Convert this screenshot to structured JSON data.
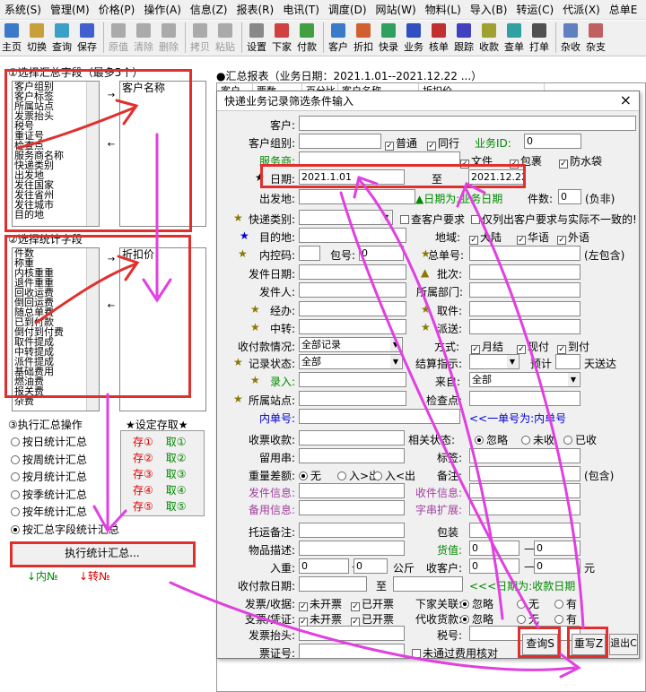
{
  "menu": [
    "系统(S)",
    "管理(M)",
    "价格(P)",
    "操作(A)",
    "信息(Z)",
    "报表(R)",
    "电讯(T)",
    "调度(D)",
    "网站(W)",
    "物料(L)",
    "导入(B)",
    "转运(C)",
    "代派(X)",
    "总单E"
  ],
  "toolbar": [
    "主页",
    "切换",
    "查询",
    "保存",
    "原值",
    "清除",
    "删除",
    "拷贝",
    "粘贴",
    "设置",
    "下家",
    "付款",
    "客户",
    "折扣",
    "快录",
    "业务",
    "核单",
    "跟踪",
    "收款",
    "查单",
    "打单",
    "杂收",
    "杂支"
  ],
  "left": {
    "select_title": "①选择汇总字段（最多5个）",
    "select_items": [
      "客户组别",
      "客户标签",
      "所属站点",
      "发票抬头",
      "税号",
      "重证号",
      "检查点",
      "服务商名称",
      "快递类别",
      "出发地",
      "发往国家",
      "发往省州",
      "发往城市",
      "目的地"
    ],
    "selected_select": "客户名称",
    "stat_title": "②选择统计字段",
    "stat_items": [
      "件数",
      "称重",
      "内核重重",
      "退件重重",
      "回收运费",
      "倒回运费",
      "随总单费",
      "已到付款",
      "倒付到付费",
      "取件提成",
      "中转提成",
      "派件提成",
      "基础费用",
      "燃油费",
      "报关费",
      "杂费"
    ],
    "selected_stat": "折扣价",
    "exec_title": "③执行汇总操作",
    "options": [
      "按日统计汇总",
      "按周统计汇总",
      "按月统计汇总",
      "按季统计汇总",
      "按年统计汇总",
      "按汇总字段统计汇总"
    ],
    "store_title": "★设定存取★",
    "store_save": [
      "存①",
      "存②",
      "存③",
      "存④",
      "存⑤"
    ],
    "store_load": [
      "取①",
      "取②",
      "取③",
      "取④",
      "取⑤"
    ],
    "exec_button": "执行统计汇总...",
    "foot_in": "↓内№",
    "foot_out": "↓转№"
  },
  "report": {
    "title": "●汇总报表（业务日期：2021.1.01--2021.12.22 ...）",
    "cols": [
      "客户",
      "票数",
      "百分比",
      "客户名称",
      "折扣价"
    ]
  },
  "dialog": {
    "title": "快递业务记录筛选条件输入",
    "close": "×",
    "l": {
      "customer": "客户:",
      "group": "客户组别:",
      "provider": "服务商:",
      "date": "日期:",
      "origin": "出发地:",
      "ktype": "快递类别:",
      "dest": "目的地:",
      "inner": "内控码:",
      "bag": "包号:",
      "sdate": "发件日期:",
      "sender": "发件人:",
      "handler": "经办:",
      "transit": "中转:",
      "paystat": "收付款情况:",
      "recstat": "记录状态:",
      "entry": "录入:",
      "site": "所属站点:",
      "inno": "内单号:",
      "recv": "收票收款:",
      "keep": "留用串:",
      "wdiff": "重量差额:",
      "sendinfo": "发件信息:",
      "backinfo": "备用信息:",
      "consign": "托运备注:",
      "goods": "物品描述:",
      "weight": "入重:",
      "paydate": "收付款日期:",
      "invoice": "发票/收据:",
      "voucher": "支票/凭证:",
      "invtitle": "发票抬头:",
      "certno": "票证号:"
    },
    "r": {
      "bizid": "业务ID:",
      "bizid_val": "0",
      "common": "普通",
      "peer": "同行",
      "doc": "文件",
      "pkg": "包裹",
      "water": "防水袋",
      "to": "至",
      "datehint": "▲日期为:业务日期",
      "pieces": "件数:",
      "pieces_val": "0",
      "neg": "(负非)",
      "cust_req": "查客户要求",
      "cust_diff": "仅列出客户要求与实际不一致的!",
      "region": "地域:",
      "mainland": "大陆",
      "chinese": "华语",
      "foreign": "外语",
      "master": "总单号:",
      "left_inc": "(左包含)",
      "batch": "批次:",
      "dept": "所属部门:",
      "pickup": "取件:",
      "dispatch": "派送:",
      "mode": "方式:",
      "monthly": "月结",
      "cash": "现付",
      "arrive": "到付",
      "settle": "结算指示:",
      "prepay": "预计",
      "dayarrive": "天送达",
      "from": "来自:",
      "check": "检查点:",
      "singleno": "<<一单号为:内单号",
      "related": "相关状态:",
      "ignore": "忽略",
      "unrecv": "未收",
      "recved": "已收",
      "tag": "标签:",
      "note": "备注:",
      "incl": "(包含)",
      "recvinfo": "收件信息:",
      "strext": "字串扩展:",
      "pack": "包装",
      "goodsval": "货值:",
      "kg": "公斤",
      "income": "收客户:",
      "yuan": "元",
      "payhint": "<<<日期为:收款日期",
      "downlink": "下家关联:",
      "none": "无",
      "have": "有",
      "agentpay": "代收货款:",
      "taxno": "税号:",
      "nofee": "未通过费用核对"
    },
    "opt": {
      "none": "无",
      "inout": "入>出",
      "outin": "入<出",
      "unopened": "未开票",
      "opened": "已开票"
    },
    "val": {
      "date_from": "2021.1.01",
      "date_to": "2021.12.22",
      "bag": "0",
      "paystat": "全部记录",
      "recstat": "全部",
      "from": "全部",
      "w_from": "0",
      "w_to": "0",
      "inc_from": "0",
      "inc_to": "0",
      "gv_from": "0",
      "gv_to": "0",
      "dash": "—"
    },
    "btn": {
      "query": "查询S",
      "reset": "重写Z",
      "exit": "退出C"
    }
  }
}
